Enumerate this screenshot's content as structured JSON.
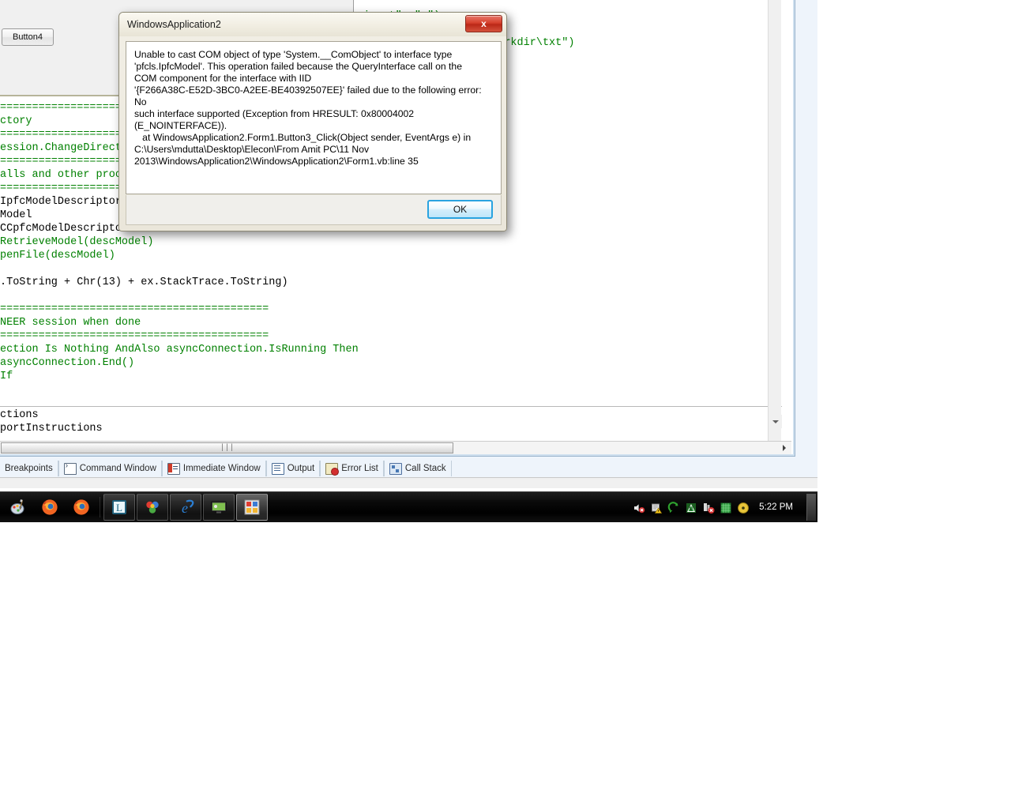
{
  "dialog": {
    "title": "WindowsApplication2",
    "close_label": "x",
    "message": "Unable to cast COM object of type 'System.__ComObject' to interface type\n'pfcls.IpfcModel'. This operation failed because the QueryInterface call on the\nCOM component for the interface with IID\n'{F266A38C-E52D-3BC0-A2EE-BE40392507EE}' failed due to the following error: No\nsuch interface supported (Exception from HRESULT: 0x80004002\n(E_NOINTERFACE)).\n   at WindowsApplication2.Form1.Button3_Click(Object sender, EventArgs e) in\nC:\\Users\\mdutta\\Desktop\\Elecon\\From Amit PC\\11 Nov\n2013\\WindowsApplication2\\WindowsApplication2\\Form1.vb:line 35",
    "ok_label": "OK"
  },
  "form": {
    "button4_label": "Button4"
  },
  "editor": {
    "top_lines": [
      {
        "text": "_input\", \".\")",
        "color": "green"
      },
      {
        "text": "",
        "color": "black"
      },
      {
        "text": "e\", \"D:\\Program Files\\Wrkdir\\txt\")",
        "color": "green"
      }
    ],
    "lines": [
      {
        "text": "==========================================",
        "color": "green"
      },
      {
        "text": "ctory",
        "color": "green"
      },
      {
        "text": "==========================================",
        "color": "green"
      },
      {
        "text": "ession.ChangeDirect",
        "color": "green"
      },
      {
        "text": "==========================================",
        "color": "green"
      },
      {
        "text": "alls and other proc",
        "color": "green"
      },
      {
        "text": "==========================================",
        "color": "green"
      },
      {
        "text": "IpfcModelDescriptor",
        "color": "black"
      },
      {
        "text": "Model",
        "color": "black"
      },
      {
        "text": "CCpfcModelDescripto",
        "color": "black"
      },
      {
        "text": "RetrieveModel(descModel)",
        "color": "green"
      },
      {
        "text": "penFile(descModel)",
        "color": "green"
      },
      {
        "text": "",
        "color": "black"
      },
      {
        "text": ".ToString + Chr(13) + ex.StackTrace.ToString)",
        "color": "black"
      },
      {
        "text": "",
        "color": "black"
      },
      {
        "text": "==========================================",
        "color": "green"
      },
      {
        "text": "NEER session when done",
        "color": "green"
      },
      {
        "text": "==========================================",
        "color": "green"
      },
      {
        "text": "ection Is Nothing AndAlso asyncConnection.IsRunning Then",
        "color": "green"
      },
      {
        "text": "asyncConnection.End()",
        "color": "green"
      },
      {
        "text": "If",
        "color": "green"
      }
    ],
    "lower_lines": [
      {
        "text": "ctions",
        "color": "black"
      },
      {
        "text": "portInstructions",
        "color": "black"
      }
    ]
  },
  "dock_tabs": [
    {
      "label": "Breakpoints",
      "icon": "breakpoint-icon",
      "icon_class": "ico-cmd"
    },
    {
      "label": "Command Window",
      "icon": "command-window-icon",
      "icon_class": "ico-cmd"
    },
    {
      "label": "Immediate Window",
      "icon": "immediate-window-icon",
      "icon_class": "ico-imm"
    },
    {
      "label": "Output",
      "icon": "output-icon",
      "icon_class": "ico-out"
    },
    {
      "label": "Error List",
      "icon": "error-list-icon",
      "icon_class": "ico-err"
    },
    {
      "label": "Call Stack",
      "icon": "call-stack-icon",
      "icon_class": "ico-call"
    }
  ],
  "taskbar": {
    "items": [
      {
        "name": "paint-icon",
        "state": "launcher"
      },
      {
        "name": "firefox-icon",
        "state": "launcher"
      },
      {
        "name": "firefox-window-icon",
        "state": "launcher"
      },
      {
        "name": "lotus-notes-icon",
        "state": "pinned"
      },
      {
        "name": "creo-parametric-icon",
        "state": "pinned"
      },
      {
        "name": "internet-explorer-icon",
        "state": "pinned"
      },
      {
        "name": "remote-desktop-icon",
        "state": "pinned"
      },
      {
        "name": "visual-studio-icon",
        "state": "active"
      }
    ],
    "tray": [
      {
        "name": "disc-icon"
      },
      {
        "name": "green-grid-icon"
      },
      {
        "name": "network-error-icon"
      },
      {
        "name": "antivirus-icon"
      },
      {
        "name": "sync-icon"
      },
      {
        "name": "action-center-warning-icon"
      },
      {
        "name": "volume-muted-icon"
      }
    ],
    "clock": "5:22 PM"
  },
  "scrollbars": {
    "horizontal_grip": "|||"
  }
}
